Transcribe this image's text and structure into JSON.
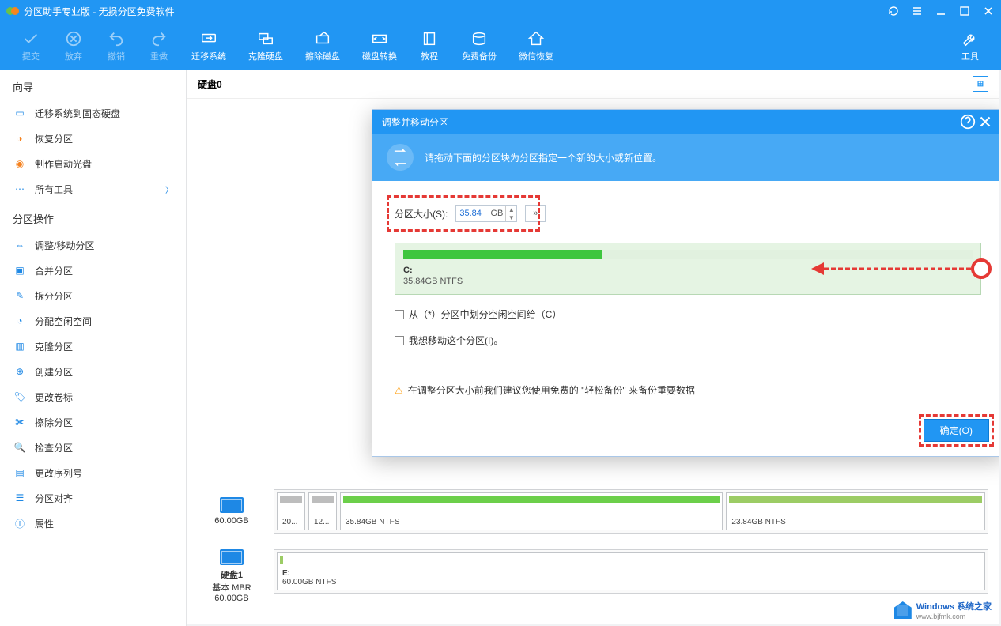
{
  "titlebar": {
    "title": "分区助手专业版 - 无损分区免费软件"
  },
  "toolbar": {
    "commit": "提交",
    "discard": "放弃",
    "undo": "撤销",
    "redo": "重做",
    "migrate": "迁移系统",
    "clone": "克隆硬盘",
    "wipe": "擦除磁盘",
    "convert": "磁盘转换",
    "tutorial": "教程",
    "backup": "免费备份",
    "wechat": "微信恢复",
    "tools": "工具"
  },
  "sidebar": {
    "wizard_title": "向导",
    "wizard": [
      "迁移系统到固态硬盘",
      "恢复分区",
      "制作启动光盘",
      "所有工具"
    ],
    "ops_title": "分区操作",
    "ops": [
      "调整/移动分区",
      "合并分区",
      "拆分分区",
      "分配空闲空间",
      "克隆分区",
      "创建分区",
      "更改卷标",
      "擦除分区",
      "检查分区",
      "更改序列号",
      "分区对齐",
      "属性"
    ]
  },
  "content": {
    "disk0": "硬盘0"
  },
  "disk0": {
    "name": "",
    "type": "",
    "size": "60.00GB",
    "parts": [
      {
        "label": "20..."
      },
      {
        "label": "12..."
      },
      {
        "label": "35.84GB NTFS"
      },
      {
        "label": "23.84GB NTFS"
      }
    ]
  },
  "disk1": {
    "name": "硬盘1",
    "type": "基本 MBR",
    "size": "60.00GB",
    "parts": [
      {
        "label": "E:",
        "size": "60.00GB NTFS"
      }
    ]
  },
  "dialog": {
    "title": "调整并移动分区",
    "banner": "请拖动下面的分区块为分区指定一个新的大小或新位置。",
    "size_label": "分区大小(S):",
    "size_value": "35.84",
    "size_unit": "GB",
    "part_letter": "C:",
    "part_size": "35.84GB NTFS",
    "chk1": "从（*）分区中划分空闲空间给（C）",
    "chk2": "我想移动这个分区(I)。",
    "warning": "在调整分区大小前我们建议您使用免费的 \"轻松备份\" 来备份重要数据",
    "ok": "确定(O)"
  },
  "watermark": {
    "line1": "Windows 系统之家",
    "line2": "www.bjfmk.com"
  }
}
